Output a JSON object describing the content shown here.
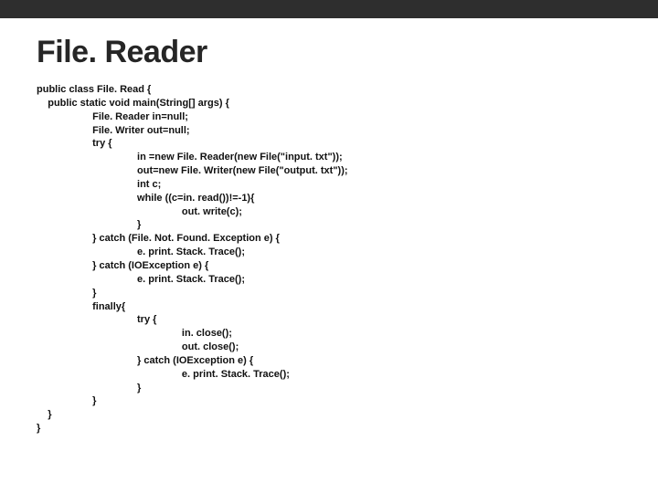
{
  "title": "File. Reader",
  "code": "public class File. Read {\n    public static void main(String[] args) {\n                    File. Reader in=null;\n                    File. Writer out=null;\n                    try {\n                                    in =new File. Reader(new File(\"input. txt\"));\n                                    out=new File. Writer(new File(\"output. txt\"));\n                                    int c;\n                                    while ((c=in. read())!=-1){\n                                                    out. write(c);\n                                    }\n                    } catch (File. Not. Found. Exception e) {\n                                    e. print. Stack. Trace();\n                    } catch (IOException e) {\n                                    e. print. Stack. Trace();\n                    }\n                    finally{\n                                    try {\n                                                    in. close();\n                                                    out. close();\n                                    } catch (IOException e) {\n                                                    e. print. Stack. Trace();\n                                    }\n                    }\n    }\n}"
}
